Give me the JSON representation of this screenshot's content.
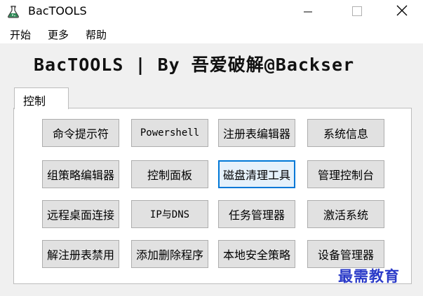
{
  "window": {
    "title": "BacTOOLS",
    "icon": "flask-icon",
    "controls": [
      "minimize-icon",
      "maximize-icon",
      "close-icon"
    ]
  },
  "menu": {
    "items": [
      "开始",
      "更多",
      "帮助"
    ]
  },
  "banner": {
    "title": "BacTOOLS | By 吾爱破解@Backser"
  },
  "tabs": [
    {
      "label": "控制",
      "selected": true
    }
  ],
  "buttons": [
    {
      "label": "命令提示符"
    },
    {
      "label": "Powershell"
    },
    {
      "label": "注册表编辑器"
    },
    {
      "label": "系统信息"
    },
    {
      "label": "组策略编辑器"
    },
    {
      "label": "控制面板"
    },
    {
      "label": "磁盘清理工具",
      "focused": true
    },
    {
      "label": "管理控制台"
    },
    {
      "label": "远程桌面连接"
    },
    {
      "label": "IP与DNS"
    },
    {
      "label": "任务管理器"
    },
    {
      "label": "激活系统"
    },
    {
      "label": "解注册表禁用"
    },
    {
      "label": "添加删除程序"
    },
    {
      "label": "本地安全策略"
    },
    {
      "label": "设备管理器"
    }
  ],
  "watermark": {
    "text": "最需教育"
  },
  "colors": {
    "focus_border": "#0078d7",
    "watermark": "#2a3ac8"
  }
}
